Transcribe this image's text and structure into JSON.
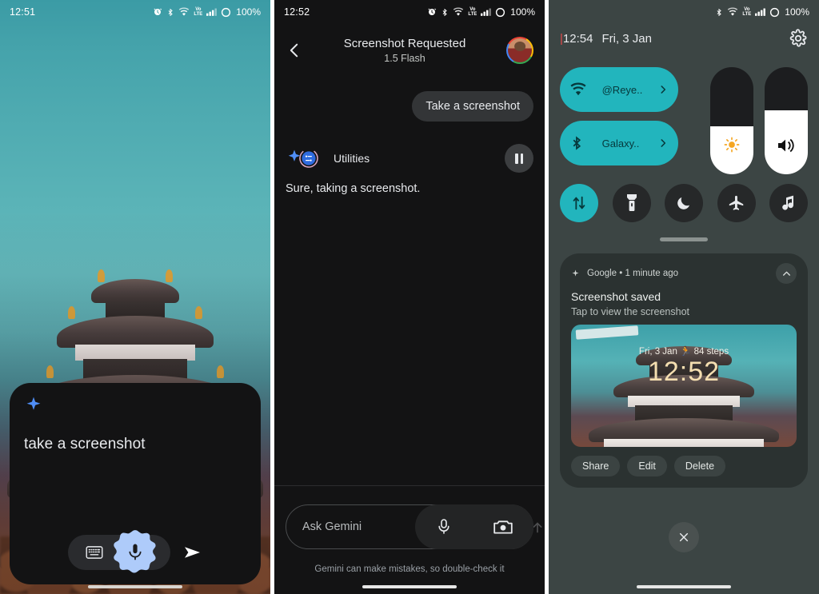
{
  "panel1": {
    "name": "gemini-overlay-on-lockscreen",
    "status_bar": {
      "time": "12:51",
      "battery": "100%",
      "network": "VoLTE"
    },
    "assistant": {
      "query_text": "take a screenshot"
    },
    "input_bar": {
      "keyboard_icon": "keyboard-icon",
      "mic_icon": "microphone-icon",
      "camera_icon": "camera-icon",
      "send_icon": "send-icon"
    }
  },
  "panel2": {
    "name": "gemini-chat",
    "status_bar": {
      "time": "12:52",
      "battery": "100%",
      "network": "VoLTE"
    },
    "header": {
      "back_icon": "back-chevron-icon",
      "title": "Screenshot Requested",
      "subtitle": "1.5 Flash",
      "avatar": "user-avatar"
    },
    "messages": [
      {
        "role": "user",
        "text": "Take a screenshot"
      },
      {
        "role": "assistant",
        "extension": "Utilities",
        "text": "Sure, taking a screenshot."
      }
    ],
    "pause_button": "pause-icon",
    "composer": {
      "placeholder": "Ask Gemini",
      "mic_icon": "microphone-icon",
      "camera_icon": "camera-icon"
    },
    "disclaimer": "Gemini can make mistakes, so double-check it"
  },
  "panel3": {
    "name": "quick-settings-shade",
    "status_bar": {
      "battery": "100%",
      "network": "VoLTE"
    },
    "clock": {
      "time": "12:54",
      "date": "Fri, 3 Jan"
    },
    "settings_icon": "gear-icon",
    "tiles": [
      {
        "id": "wifi",
        "label": "@Reye..",
        "icon": "wifi-icon",
        "state": "on",
        "chevron": "chevron-right-icon"
      },
      {
        "id": "bluetooth",
        "label": "Galaxy..",
        "icon": "bluetooth-icon",
        "state": "on",
        "chevron": "chevron-right-icon"
      }
    ],
    "sliders": [
      {
        "id": "brightness",
        "icon": "brightness-sun-icon",
        "level": 45
      },
      {
        "id": "volume",
        "icon": "volume-speaker-icon",
        "level": 60
      }
    ],
    "toggles": [
      {
        "id": "mobile-data",
        "icon": "data-transfer-icon",
        "state": "on"
      },
      {
        "id": "flashlight",
        "icon": "flashlight-icon",
        "state": "off"
      },
      {
        "id": "do-not-disturb",
        "icon": "moon-icon",
        "state": "off"
      },
      {
        "id": "airplane-mode",
        "icon": "airplane-icon",
        "state": "off"
      },
      {
        "id": "sound-mode",
        "icon": "music-note-icon",
        "state": "off"
      }
    ],
    "notification": {
      "app": "Google",
      "separator": "•",
      "time": "1 minute ago",
      "expand_icon": "chevron-up-icon",
      "title": "Screenshot saved",
      "body": "Tap to view the screenshot",
      "preview": {
        "meta": "Fri, 3 Jan",
        "steps_icon": "walking-icon",
        "steps": "84 steps",
        "clock": "12:52"
      },
      "actions": [
        "Share",
        "Edit",
        "Delete"
      ]
    },
    "close_icon": "close-icon"
  },
  "colors": {
    "accent_teal": "#22b5bd",
    "wallpaper_sky": "#55b2b6",
    "dark_surface": "#131314",
    "shade_bg": "#3c4544",
    "gemini_blue": "#4f8ef7",
    "mic_blob": "#aecbfa"
  }
}
